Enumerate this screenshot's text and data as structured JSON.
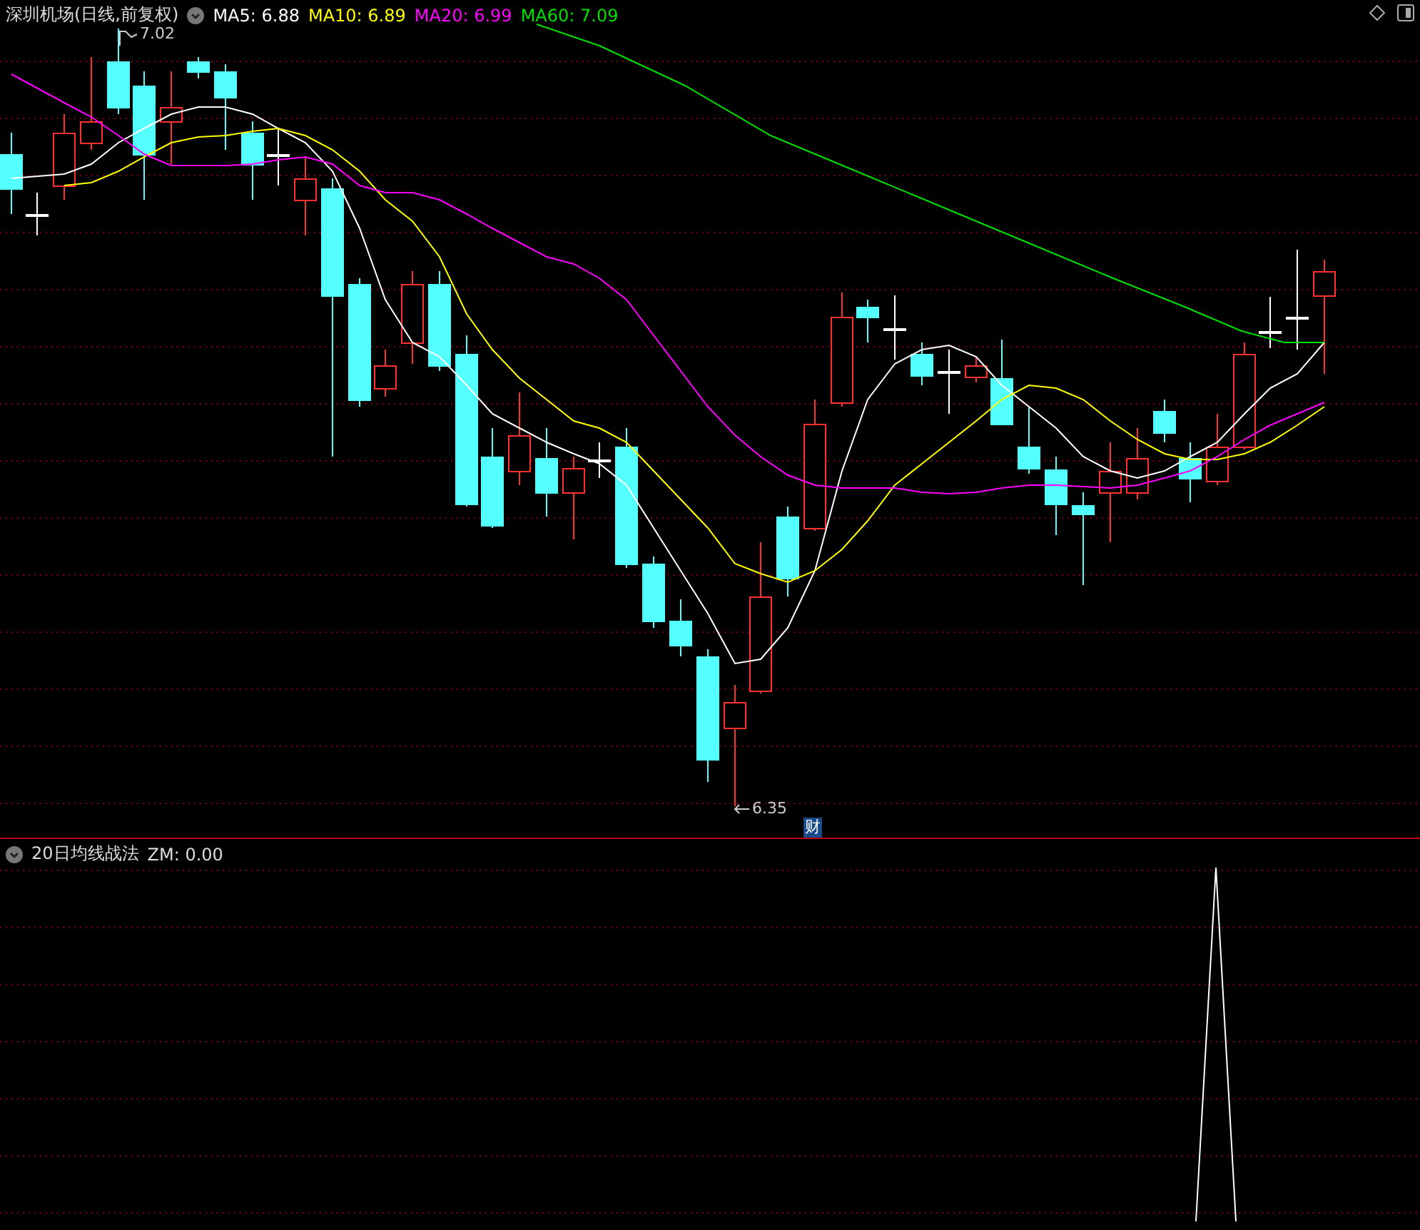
{
  "main_chart": {
    "title": "深圳机场(日线,前复权)",
    "indicators": [
      {
        "label": "MA5: 6.88",
        "color": "#ffffff"
      },
      {
        "label": "MA10: 6.89",
        "color": "#ffff00"
      },
      {
        "label": "MA20: 6.99",
        "color": "#ff00ff"
      },
      {
        "label": "MA60: 7.09",
        "color": "#00e000"
      }
    ],
    "high_label": "7.02",
    "low_label": "6.35",
    "event_badge": "财"
  },
  "sub_chart": {
    "title": "20日均线战法",
    "reading": "ZM: 0.00"
  }
}
